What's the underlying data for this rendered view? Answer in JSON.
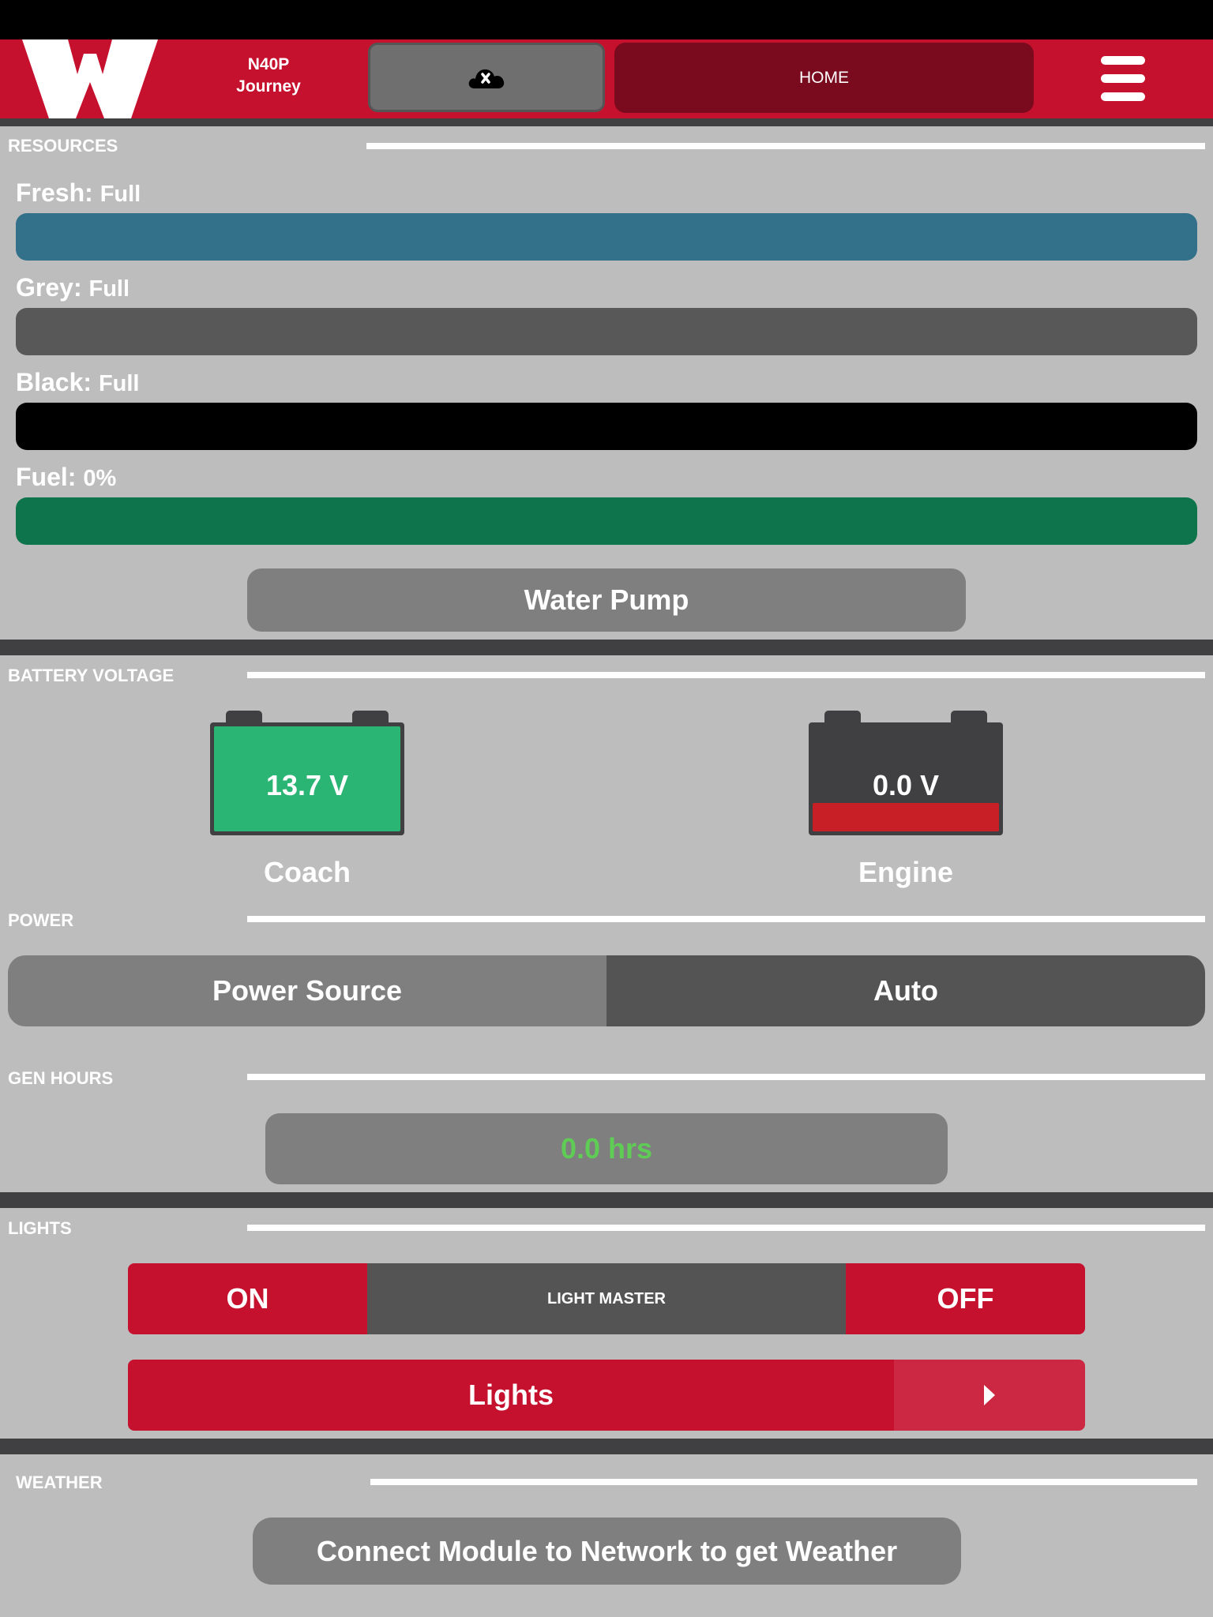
{
  "header": {
    "logo_letter": "W",
    "model_line1": "N40P",
    "model_line2": "Journey",
    "cloud_status_icon": "cloud-disconnected-icon",
    "home_label": "HOME",
    "menu_icon": "hamburger-menu-icon"
  },
  "resources": {
    "section_label": "RESOURCES",
    "tanks": [
      {
        "name": "Fresh:",
        "value": "Full",
        "color": "#337089",
        "level_percent": 100
      },
      {
        "name": "Grey:",
        "value": "Full",
        "color": "#585858",
        "level_percent": 100
      },
      {
        "name": "Black:",
        "value": "Full",
        "color": "#000000",
        "level_percent": 100
      },
      {
        "name": "Fuel:",
        "value": "0%",
        "color": "#0e744c",
        "level_percent": 0
      }
    ],
    "water_pump_label": "Water Pump"
  },
  "battery": {
    "section_label": "BATTERY VOLTAGE",
    "coach": {
      "value": "13.7 V",
      "name": "Coach",
      "color": "#2bb574"
    },
    "engine": {
      "value": "0.0 V",
      "name": "Engine",
      "color": "#c81f27"
    }
  },
  "power": {
    "section_label": "POWER",
    "source_label": "Power Source",
    "source_value": "Auto"
  },
  "gen_hours": {
    "section_label": "GEN HOURS",
    "value": "0.0 hrs",
    "value_color": "#5fcc55"
  },
  "lights": {
    "section_label": "LIGHTS",
    "on_label": "ON",
    "master_label": "LIGHT MASTER",
    "off_label": "OFF",
    "lights_label": "Lights",
    "arrow_icon": "chevron-right-icon"
  },
  "weather": {
    "section_label": "WEATHER",
    "message": "Connect Module to Network to get Weather"
  },
  "colors": {
    "brand_red": "#c5102e",
    "home_dark_red": "#7a0a1e",
    "background": "#bdbdbd",
    "separator": "#404042"
  }
}
